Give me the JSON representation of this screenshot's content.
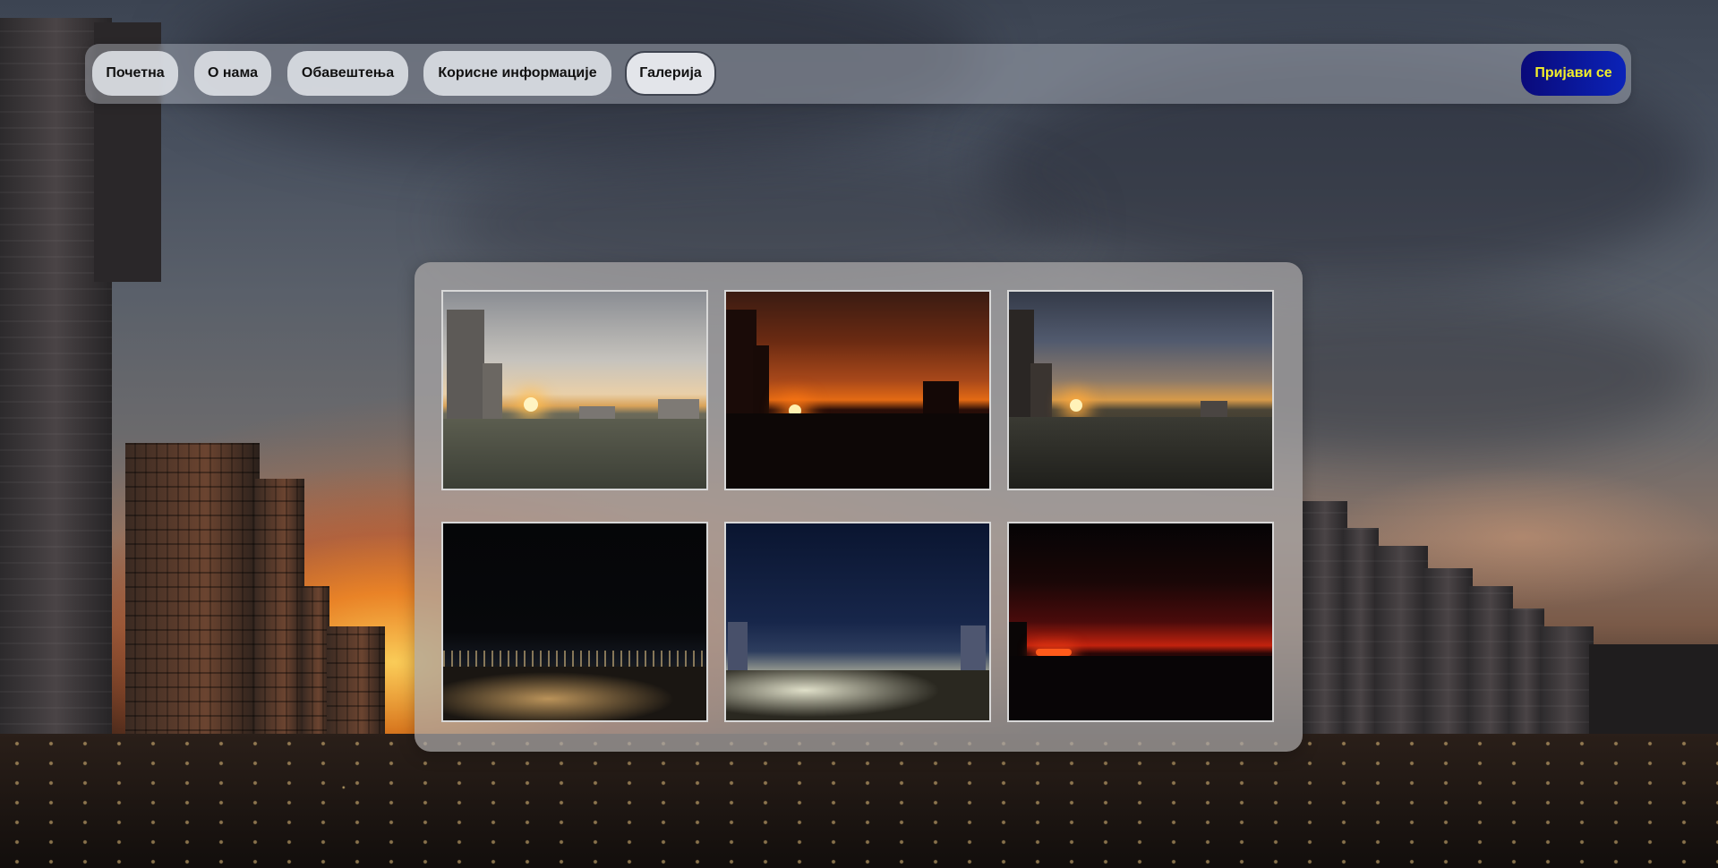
{
  "nav": {
    "items": [
      {
        "label": "Почетна"
      },
      {
        "label": "О нама"
      },
      {
        "label": "Обавештења"
      },
      {
        "label": "Корисне информације"
      },
      {
        "label": "Галерија",
        "active": true
      }
    ],
    "login_label": "Пријави се"
  },
  "colors": {
    "login_bg": "#0b23b8",
    "login_text": "#f2ee2a",
    "panel_bg": "#aaa8a8"
  },
  "gallery": {
    "photos": [
      {
        "scene": "cloudy-sunset-street"
      },
      {
        "scene": "red-sunset-silhouette"
      },
      {
        "scene": "blue-sky-sunset-street"
      },
      {
        "scene": "night-city-lights"
      },
      {
        "scene": "blue-hour-city"
      },
      {
        "scene": "dark-red-night-sky"
      }
    ]
  }
}
